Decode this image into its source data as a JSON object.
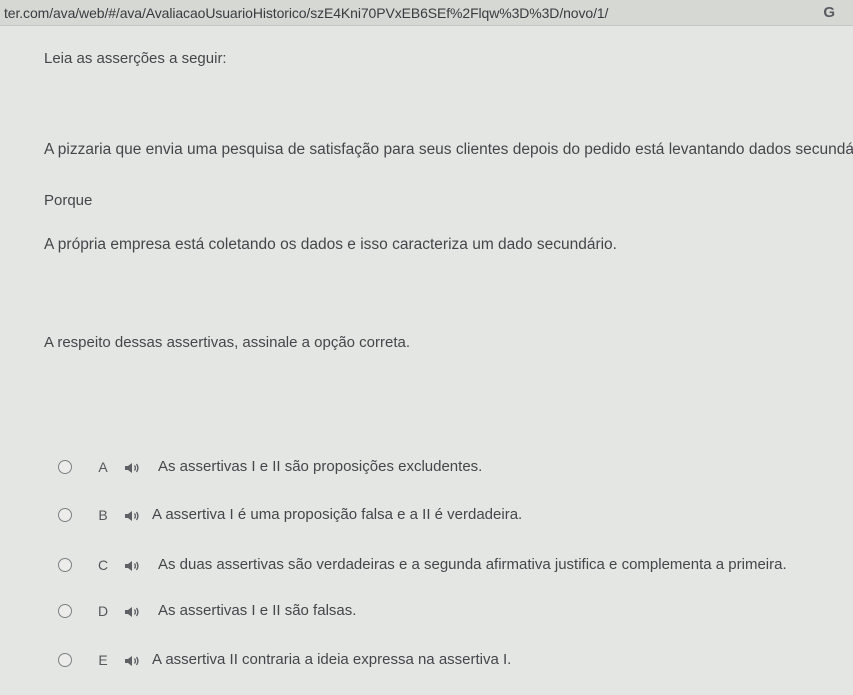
{
  "browser": {
    "url": "ter.com/ava/web/#/ava/AvaliacaoUsuarioHistorico/szE4Kni70PVxEB6SEf%2Flqw%3D%3D/novo/1/",
    "refresh_icon": "G"
  },
  "question": {
    "instruction": "Leia as asserções a seguir:",
    "assertion_1": "A pizzaria que envia uma pesquisa de satisfação para seus clientes depois do pedido está levantando dados secundários.",
    "connector": "Porque",
    "assertion_2": "A própria empresa está coletando os dados e isso caracteriza um dado secundário.",
    "prompt": "A respeito dessas assertivas, assinale a opção correta."
  },
  "options": [
    {
      "letter": "A",
      "text": "As assertivas I e II são proposições excludentes."
    },
    {
      "letter": "B",
      "text": "A assertiva I é uma proposição falsa e a II é verdadeira."
    },
    {
      "letter": "C",
      "text": "As duas assertivas são verdadeiras e a segunda afirmativa justifica e complementa a primeira."
    },
    {
      "letter": "D",
      "text": "As assertivas I e II são falsas."
    },
    {
      "letter": "E",
      "text": "A assertiva II contraria a ideia expressa na assertiva I."
    }
  ],
  "icons": {
    "audio": "speaker-icon",
    "radio": "radio-circle"
  }
}
